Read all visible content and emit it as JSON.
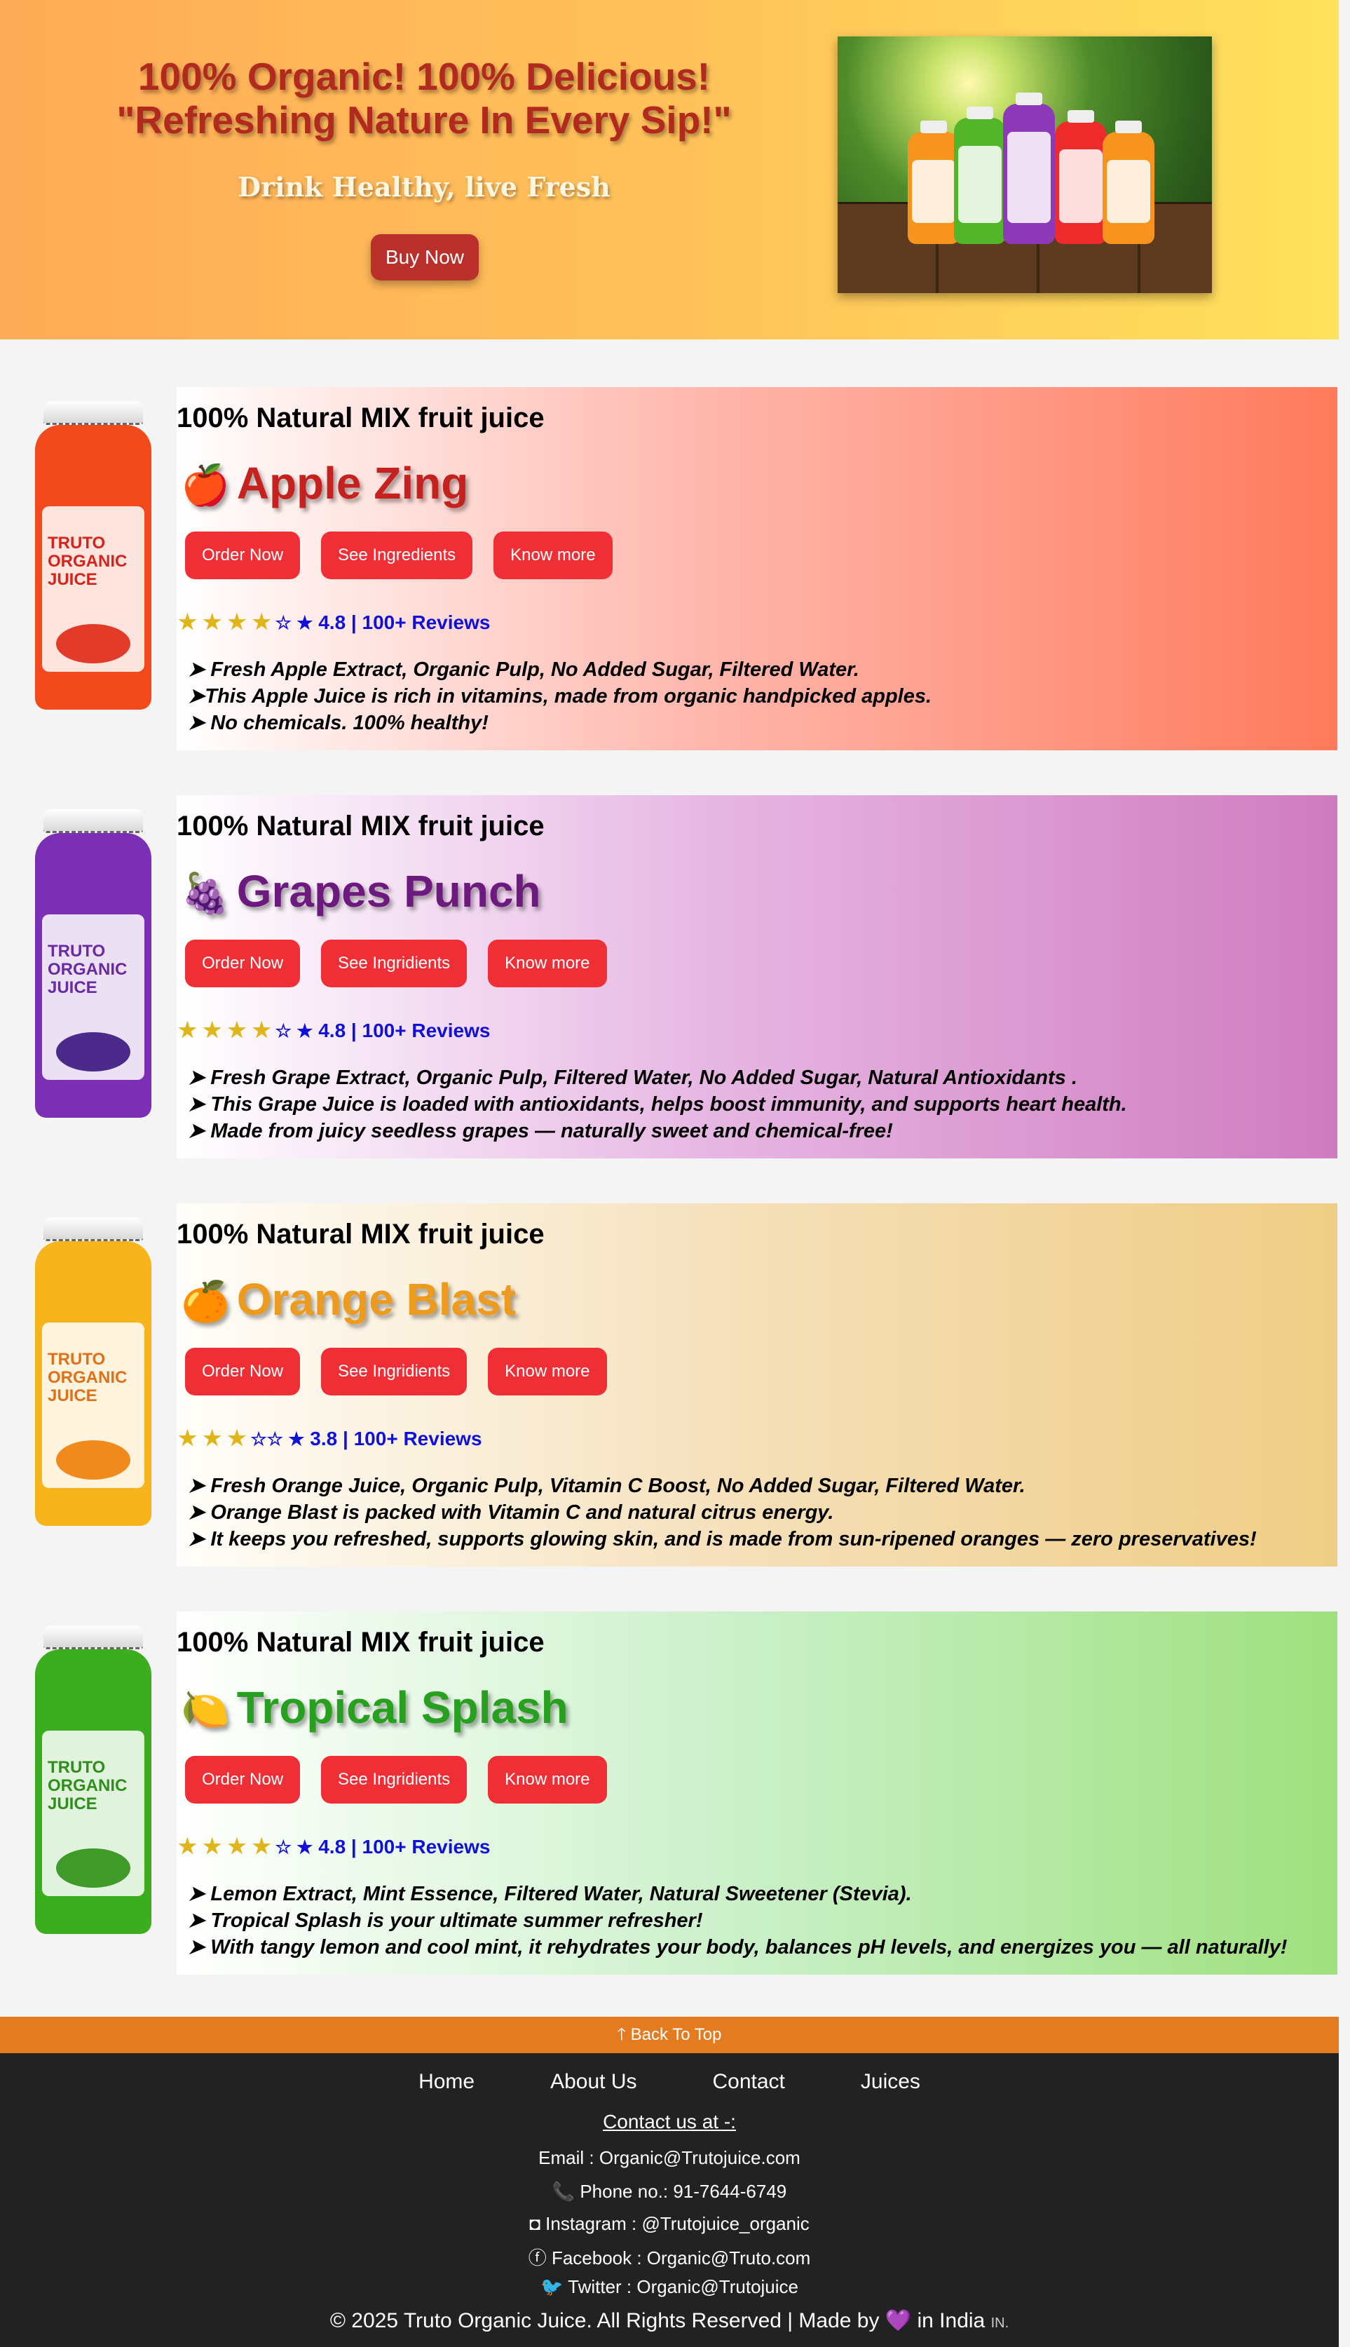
{
  "hero": {
    "headline_1": "100% Organic! 100% Delicious!",
    "headline_2": "\"Refreshing Nature In Every Sip!\"",
    "subheadline": "Drink Healthy, live Fresh",
    "buy_label": "Buy Now"
  },
  "products": [
    {
      "title": "100% Natural MIX fruit juice",
      "emoji": "🍎",
      "name": "Apple Zing",
      "name_color": "#c5221f",
      "buttons": [
        "Order Now",
        "See Ingredients",
        "Know more"
      ],
      "stars_filled": "★ ★ ★ ★",
      "stars_empty": "☆ ★",
      "rating_text": "4.8 | 100+ Reviews",
      "bullets": [
        "➤ Fresh Apple Extract, Organic Pulp, No Added Sugar, Filtered Water.",
        "➤This Apple Juice is rich in vitamins, made from organic handpicked apples.",
        "➤ No chemicals. 100% healthy!"
      ],
      "bottle_brand": "TRUTO ORGANIC JUICE",
      "bottle_color": "#f24a1c",
      "brand_color": "#d4241d",
      "fruit_color": "#e33b2a",
      "panel_gradient": "linear-gradient(90deg, #ffffff 0%, #ffb7ad 45%, #ff7a5c 100%)"
    },
    {
      "title": "100% Natural MIX fruit juice",
      "emoji": "🍇",
      "name": "Grapes Punch",
      "name_color": "#6c1a7e",
      "buttons": [
        "Order Now",
        "See Ingridients",
        "Know more"
      ],
      "stars_filled": "★ ★ ★ ★",
      "stars_empty": "☆ ★",
      "rating_text": "4.8 | 100+ Reviews",
      "bullets": [
        "➤ Fresh Grape Extract, Organic Pulp, Filtered Water, No Added Sugar, Natural Antioxidants .",
        "➤ This Grape Juice is loaded with antioxidants, helps boost immunity, and supports heart health.",
        "➤ Made from juicy seedless grapes — naturally sweet and chemical-free!"
      ],
      "bottle_brand": "TRUTO ORGANIC JUICE",
      "bottle_color": "#7b2fb5",
      "brand_color": "#6a2aa3",
      "fruit_color": "#4b2a8c",
      "panel_gradient": "linear-gradient(90deg, #ffffff 0%, #e7b8e4 45%, #cf7cbf 100%)"
    },
    {
      "title": "100% Natural MIX fruit juice",
      "emoji": "🍊",
      "name": "Orange Blast",
      "name_color": "#ec9b1e",
      "buttons": [
        "Order Now",
        "See Ingridients",
        "Know more"
      ],
      "stars_filled": "★ ★ ★",
      "stars_empty": "☆☆ ★",
      "rating_text": "3.8 | 100+ Reviews",
      "bullets": [
        "➤ Fresh Orange Juice, Organic Pulp, Vitamin C Boost, No Added Sugar, Filtered Water.",
        "➤ Orange Blast is packed with Vitamin C and natural citrus energy.",
        "➤ It keeps you refreshed, supports glowing skin, and is made from sun-ripened oranges — zero preservatives!"
      ],
      "bottle_brand": "TRUTO ORGANIC JUICE",
      "bottle_color": "#f7b41b",
      "brand_color": "#e0701a",
      "fruit_color": "#f08a1c",
      "panel_gradient": "linear-gradient(90deg, #fffefa 0%, #f5dfb8 50%, #efcd85 100%)"
    },
    {
      "title": "100% Natural MIX fruit juice",
      "emoji": "🍋",
      "name": "Tropical Splash",
      "name_color": "#27a01f",
      "buttons": [
        "Order Now",
        "See Ingridients",
        "Know more"
      ],
      "stars_filled": "★ ★ ★ ★",
      "stars_empty": "☆ ★",
      "rating_text": "4.8 | 100+ Reviews",
      "bullets": [
        "➤ Lemon Extract, Mint Essence, Filtered Water, Natural Sweetener (Stevia).",
        "➤ Tropical Splash is your ultimate summer refresher!",
        "➤ With tangy lemon and cool mint, it rehydrates your body, balances pH levels, and energizes you — all naturally!"
      ],
      "bottle_brand": "TRUTO ORGANIC JUICE",
      "bottle_color": "#3cad1e",
      "brand_color": "#2f8f1c",
      "fruit_color": "#3f9a2a",
      "panel_gradient": "linear-gradient(90deg, #ffffff 0%, #c9f0c7 50%, #9fe07e 100%)"
    }
  ],
  "back_to_top": "🡑 Back To Top",
  "footer": {
    "nav": [
      "Home",
      "About Us",
      "Contact",
      "Juices"
    ],
    "contact_heading": "Contact us at -:",
    "email": "Email : Organic@Trutojuice.com",
    "phone": "📞 Phone no.: 91-7644-6749",
    "instagram": "Instagram : @Trutojuice_organic",
    "facebook": "Facebook : Organic@Truto.com",
    "twitter": "Twitter : Organic@Trutojuice",
    "copyright": "© 2025 Truto Organic Juice. All Rights Reserved | Made by 💜 in India",
    "copyright_tag": "IN."
  },
  "colors": {
    "button_red": "#ef2f35",
    "back_top_orange": "#e57b21",
    "footer_bg": "#222222",
    "rating_blue": "#1010d8"
  }
}
